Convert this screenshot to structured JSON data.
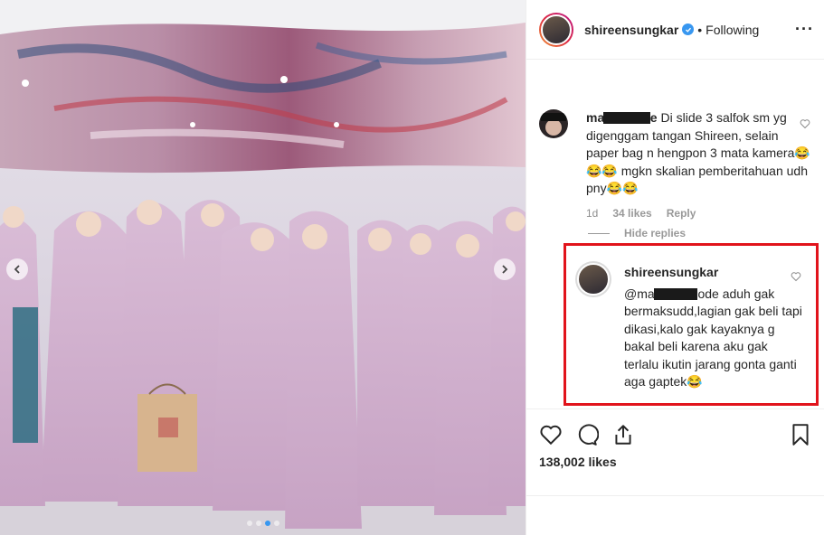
{
  "post": {
    "username": "shireensungkar",
    "verified_icon": "verified-badge-icon",
    "separator": "•",
    "follow_state": "Following",
    "more_icon": "more-options-icon"
  },
  "comments": [
    {
      "user_prefix": "mau",
      "user_suffix": "e",
      "text": "Di slide 3 salfok sm yg digenggam tangan Shireen, selain paper bag n hengpon 3 mata kamera😂😂😂 mgkn skalian pemberitahuan udh pny😂😂",
      "age": "1d",
      "likes": "34 likes",
      "reply_label": "Reply",
      "hide_replies_label": "Hide replies"
    }
  ],
  "reply": {
    "username": "shireensungkar",
    "mention_prefix": "@mau",
    "mention_suffix": "ode",
    "text": "aduh gak bermaksudd,lagian gak beli tapi dikasi,kalo gak kayaknya g bakal beli karena aku gak terlalu ikutin jarang gonta ganti aga gaptek😂"
  },
  "actions": {
    "like_icon": "heart-icon",
    "comment_icon": "comment-icon",
    "share_icon": "share-icon",
    "save_icon": "bookmark-icon",
    "likes_count": "138,002 likes"
  },
  "carousel": {
    "dots": 4,
    "active_dot": 3
  },
  "colors": {
    "verified": "#3897f0",
    "highlight_box": "#e1131b",
    "muted_text": "#8e8e8e"
  }
}
